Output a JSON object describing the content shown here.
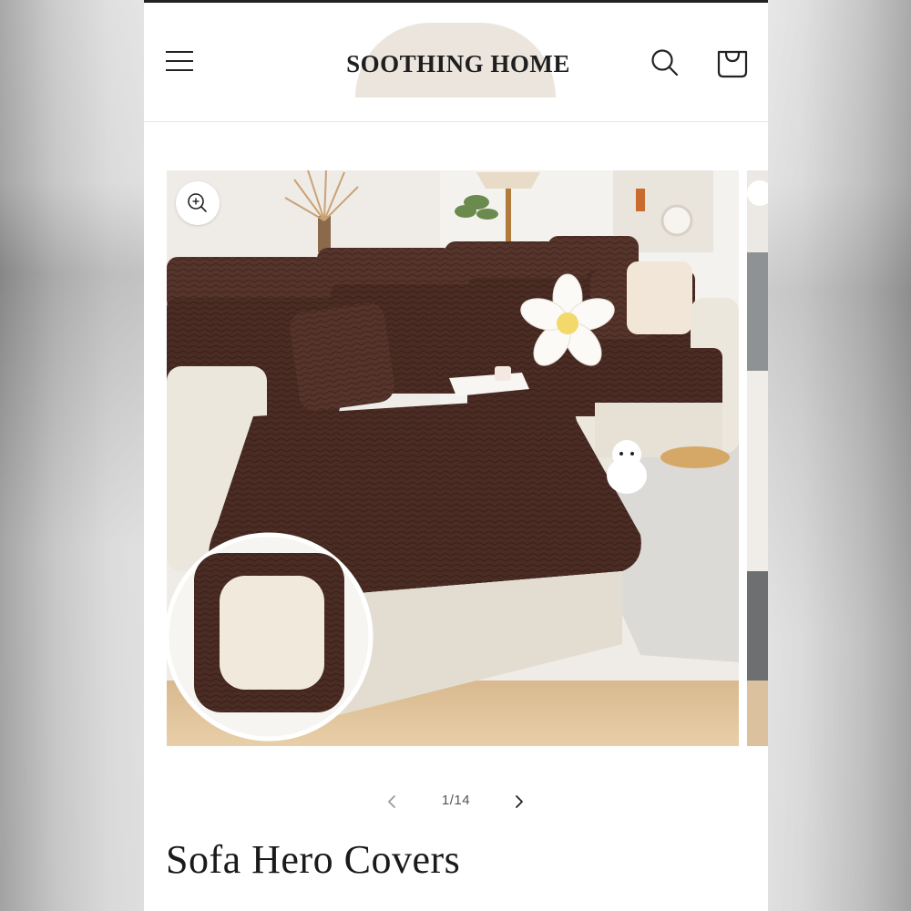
{
  "header": {
    "brand": "SOOTHING HOME",
    "menu_icon": "hamburger-menu-icon",
    "search_icon": "search-icon",
    "cart_icon": "shopping-bag-icon"
  },
  "gallery": {
    "zoom_icon": "zoom-in-icon",
    "current_image": 1,
    "total_images": 14,
    "counter": "1/14",
    "prev_icon": "chevron-left-icon",
    "next_icon": "chevron-right-icon"
  },
  "product": {
    "title": "Sofa Hero Covers"
  },
  "colors": {
    "accent_arch": "#ebe5dd",
    "sofa_cover": "#4a2c24",
    "sofa_base": "#ece7dd"
  }
}
